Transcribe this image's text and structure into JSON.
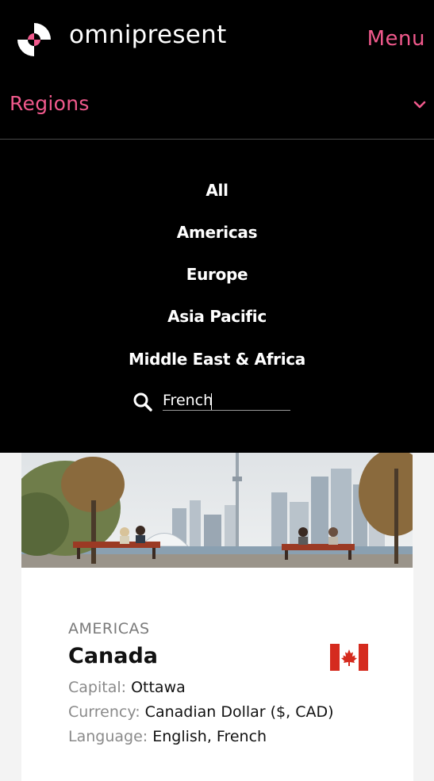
{
  "header": {
    "logo_text": "omnipresent",
    "menu_label": "Menu"
  },
  "regions": {
    "label": "Regions",
    "items": [
      "All",
      "Americas",
      "Europe",
      "Asia Pacific",
      "Middle East & Africa"
    ],
    "search_value": "French"
  },
  "card": {
    "region": "AMERICAS",
    "country": "Canada",
    "capital_label": "Capital:",
    "capital_value": "Ottawa",
    "currency_label": "Currency:",
    "currency_value": "Canadian Dollar ($, CAD)",
    "language_label": "Language:",
    "language_value": "English, French"
  },
  "colors": {
    "accent": "#f0598c",
    "background": "#000000"
  },
  "icons": {
    "logo": "omnipresent-logo-icon",
    "chevron": "chevron-down-icon",
    "search": "search-icon",
    "flag": "canada-flag-icon"
  }
}
